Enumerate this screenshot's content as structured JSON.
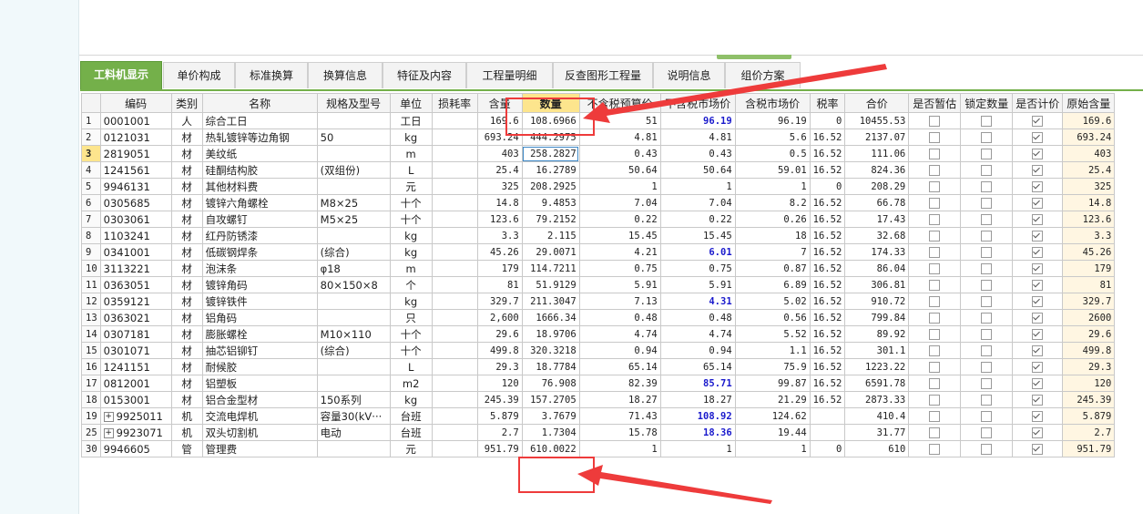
{
  "tabs": [
    {
      "label": "工料机显示",
      "active": true
    },
    {
      "label": "单价构成"
    },
    {
      "label": "标准换算"
    },
    {
      "label": "换算信息"
    },
    {
      "label": "特征及内容"
    },
    {
      "label": "工程量明细"
    },
    {
      "label": "反查图形工程量"
    },
    {
      "label": "说明信息"
    },
    {
      "label": "组价方案"
    }
  ],
  "columns": [
    "编码",
    "类别",
    "名称",
    "规格及型号",
    "单位",
    "损耗率",
    "含量",
    "数量",
    "不含税预算价",
    "不含税市场价",
    "含税市场价",
    "税率",
    "合价",
    "是否暂估",
    "锁定数量",
    "是否计价",
    "原始含量"
  ],
  "rows": [
    {
      "no": "1",
      "code": "0001001",
      "type": "人",
      "name": "综合工日",
      "spec": "",
      "unit": "工日",
      "loss": "",
      "content": "169.6",
      "qty": "108.6966",
      "pre_budget": "51",
      "pre_market": "96.19",
      "pre_market_blue": true,
      "tax_market": "96.19",
      "tax_rate": "0",
      "total": "10455.53",
      "est": false,
      "lock": false,
      "price": true,
      "orig": "169.6"
    },
    {
      "no": "2",
      "code": "0121031",
      "type": "材",
      "name": "热轧镀锌等边角钢",
      "spec": "50",
      "unit": "kg",
      "loss": "",
      "content": "693.24",
      "qty": "444.2975",
      "pre_budget": "4.81",
      "pre_market": "4.81",
      "tax_market": "5.6",
      "tax_rate": "16.52",
      "total": "2137.07",
      "est": false,
      "lock": false,
      "price": true,
      "orig": "693.24"
    },
    {
      "no": "3",
      "code": "2819051",
      "type": "材",
      "name": "美纹纸",
      "spec": "",
      "unit": "m",
      "loss": "",
      "content": "403",
      "qty": "258.2827",
      "pre_budget": "0.43",
      "pre_market": "0.43",
      "tax_market": "0.5",
      "tax_rate": "16.52",
      "total": "111.06",
      "est": false,
      "lock": false,
      "price": true,
      "orig": "403",
      "selected": true
    },
    {
      "no": "4",
      "code": "1241561",
      "type": "材",
      "name": "硅酮结构胶",
      "spec": "(双组份)",
      "unit": "L",
      "loss": "",
      "content": "25.4",
      "qty": "16.2789",
      "pre_budget": "50.64",
      "pre_market": "50.64",
      "tax_market": "59.01",
      "tax_rate": "16.52",
      "total": "824.36",
      "est": false,
      "lock": false,
      "price": true,
      "orig": "25.4"
    },
    {
      "no": "5",
      "code": "9946131",
      "type": "材",
      "name": "其他材料费",
      "spec": "",
      "unit": "元",
      "loss": "",
      "content": "325",
      "qty": "208.2925",
      "pre_budget": "1",
      "pre_market": "1",
      "tax_market": "1",
      "tax_rate": "0",
      "total": "208.29",
      "est": false,
      "lock": false,
      "price": true,
      "orig": "325"
    },
    {
      "no": "6",
      "code": "0305685",
      "type": "材",
      "name": "镀锌六角螺栓",
      "spec": "M8×25",
      "unit": "十个",
      "loss": "",
      "content": "14.8",
      "qty": "9.4853",
      "pre_budget": "7.04",
      "pre_market": "7.04",
      "tax_market": "8.2",
      "tax_rate": "16.52",
      "total": "66.78",
      "est": false,
      "lock": false,
      "price": true,
      "orig": "14.8"
    },
    {
      "no": "7",
      "code": "0303061",
      "type": "材",
      "name": "自攻螺钉",
      "spec": "M5×25",
      "unit": "十个",
      "loss": "",
      "content": "123.6",
      "qty": "79.2152",
      "pre_budget": "0.22",
      "pre_market": "0.22",
      "tax_market": "0.26",
      "tax_rate": "16.52",
      "total": "17.43",
      "est": false,
      "lock": false,
      "price": true,
      "orig": "123.6"
    },
    {
      "no": "8",
      "code": "1103241",
      "type": "材",
      "name": "红丹防锈漆",
      "spec": "",
      "unit": "kg",
      "loss": "",
      "content": "3.3",
      "qty": "2.115",
      "pre_budget": "15.45",
      "pre_market": "15.45",
      "tax_market": "18",
      "tax_rate": "16.52",
      "total": "32.68",
      "est": false,
      "lock": false,
      "price": true,
      "orig": "3.3"
    },
    {
      "no": "9",
      "code": "0341001",
      "type": "材",
      "name": "低碳钢焊条",
      "spec": "(综合)",
      "unit": "kg",
      "loss": "",
      "content": "45.26",
      "qty": "29.0071",
      "pre_budget": "4.21",
      "pre_market": "6.01",
      "pre_market_blue": true,
      "tax_market": "7",
      "tax_rate": "16.52",
      "total": "174.33",
      "est": false,
      "lock": false,
      "price": true,
      "orig": "45.26"
    },
    {
      "no": "10",
      "code": "3113221",
      "type": "材",
      "name": "泡沫条",
      "spec": "φ18",
      "unit": "m",
      "loss": "",
      "content": "179",
      "qty": "114.7211",
      "pre_budget": "0.75",
      "pre_market": "0.75",
      "tax_market": "0.87",
      "tax_rate": "16.52",
      "total": "86.04",
      "est": false,
      "lock": false,
      "price": true,
      "orig": "179"
    },
    {
      "no": "11",
      "code": "0363051",
      "type": "材",
      "name": "镀锌角码",
      "spec": "80×150×8",
      "unit": "个",
      "loss": "",
      "content": "81",
      "qty": "51.9129",
      "pre_budget": "5.91",
      "pre_market": "5.91",
      "tax_market": "6.89",
      "tax_rate": "16.52",
      "total": "306.81",
      "est": false,
      "lock": false,
      "price": true,
      "orig": "81"
    },
    {
      "no": "12",
      "code": "0359121",
      "type": "材",
      "name": "镀锌铁件",
      "spec": "",
      "unit": "kg",
      "loss": "",
      "content": "329.7",
      "qty": "211.3047",
      "pre_budget": "7.13",
      "pre_market": "4.31",
      "pre_market_blue": true,
      "tax_market": "5.02",
      "tax_rate": "16.52",
      "total": "910.72",
      "est": false,
      "lock": false,
      "price": true,
      "orig": "329.7"
    },
    {
      "no": "13",
      "code": "0363021",
      "type": "材",
      "name": "铝角码",
      "spec": "",
      "unit": "只",
      "loss": "",
      "content": "2,600",
      "qty": "1666.34",
      "pre_budget": "0.48",
      "pre_market": "0.48",
      "tax_market": "0.56",
      "tax_rate": "16.52",
      "total": "799.84",
      "est": false,
      "lock": false,
      "price": true,
      "orig": "2600"
    },
    {
      "no": "14",
      "code": "0307181",
      "type": "材",
      "name": "膨胀螺栓",
      "spec": "M10×110",
      "unit": "十个",
      "loss": "",
      "content": "29.6",
      "qty": "18.9706",
      "pre_budget": "4.74",
      "pre_market": "4.74",
      "tax_market": "5.52",
      "tax_rate": "16.52",
      "total": "89.92",
      "est": false,
      "lock": false,
      "price": true,
      "orig": "29.6"
    },
    {
      "no": "15",
      "code": "0301071",
      "type": "材",
      "name": "抽芯铝铆钉",
      "spec": "(综合)",
      "unit": "十个",
      "loss": "",
      "content": "499.8",
      "qty": "320.3218",
      "pre_budget": "0.94",
      "pre_market": "0.94",
      "tax_market": "1.1",
      "tax_rate": "16.52",
      "total": "301.1",
      "est": false,
      "lock": false,
      "price": true,
      "orig": "499.8"
    },
    {
      "no": "16",
      "code": "1241151",
      "type": "材",
      "name": "耐候胶",
      "spec": "",
      "unit": "L",
      "loss": "",
      "content": "29.3",
      "qty": "18.7784",
      "pre_budget": "65.14",
      "pre_market": "65.14",
      "tax_market": "75.9",
      "tax_rate": "16.52",
      "total": "1223.22",
      "est": false,
      "lock": false,
      "price": true,
      "orig": "29.3"
    },
    {
      "no": "17",
      "code": "0812001",
      "type": "材",
      "name": "铝塑板",
      "spec": "",
      "unit": "m2",
      "loss": "",
      "content": "120",
      "qty": "76.908",
      "pre_budget": "82.39",
      "pre_market": "85.71",
      "pre_market_blue": true,
      "tax_market": "99.87",
      "tax_rate": "16.52",
      "total": "6591.78",
      "est": false,
      "lock": false,
      "price": true,
      "orig": "120"
    },
    {
      "no": "18",
      "code": "0153001",
      "type": "材",
      "name": "铝合金型材",
      "spec": "150系列",
      "unit": "kg",
      "loss": "",
      "content": "245.39",
      "qty": "157.2705",
      "pre_budget": "18.27",
      "pre_market": "18.27",
      "tax_market": "21.29",
      "tax_rate": "16.52",
      "total": "2873.33",
      "est": false,
      "lock": false,
      "price": true,
      "orig": "245.39"
    },
    {
      "no": "19",
      "code": "9925011",
      "type": "机",
      "name": "交流电焊机",
      "spec": "容量30(kV···",
      "unit": "台班",
      "loss": "",
      "content": "5.879",
      "qty": "3.7679",
      "pre_budget": "71.43",
      "pre_market": "108.92",
      "pre_market_blue": true,
      "tax_market": "124.62",
      "tax_rate": "",
      "total": "410.4",
      "est": false,
      "lock": false,
      "price": true,
      "orig": "5.879",
      "expand": true
    },
    {
      "no": "25",
      "code": "9923071",
      "type": "机",
      "name": "双头切割机",
      "spec": "电动",
      "unit": "台班",
      "loss": "",
      "content": "2.7",
      "qty": "1.7304",
      "pre_budget": "15.78",
      "pre_market": "18.36",
      "pre_market_blue": true,
      "tax_market": "19.44",
      "tax_rate": "",
      "total": "31.77",
      "est": false,
      "lock": false,
      "price": true,
      "orig": "2.7",
      "expand": true
    },
    {
      "no": "30",
      "code": "9946605",
      "type": "管",
      "name": "管理费",
      "spec": "",
      "unit": "元",
      "loss": "",
      "content": "951.79",
      "qty": "610.0022",
      "pre_budget": "1",
      "pre_market": "1",
      "tax_market": "1",
      "tax_rate": "0",
      "total": "610",
      "est": false,
      "lock": false,
      "price": true,
      "orig": "951.79"
    }
  ],
  "annotation": {
    "color": "#ee3b3b"
  }
}
